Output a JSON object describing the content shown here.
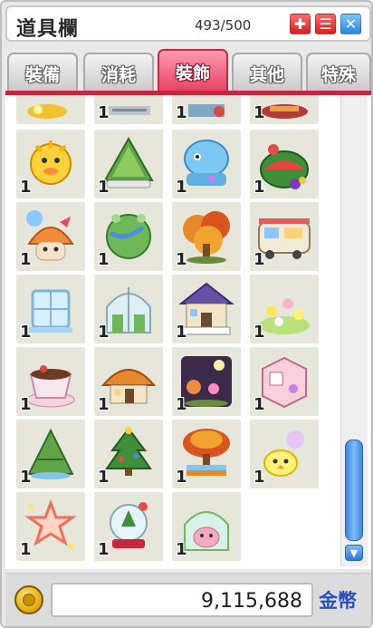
{
  "window": {
    "title": "道具欄",
    "capacity": "493/500",
    "buttons": [
      "add",
      "list",
      "close"
    ]
  },
  "tabs": [
    {
      "label": "裝備",
      "active": false
    },
    {
      "label": "消耗",
      "active": false
    },
    {
      "label": "裝飾",
      "active": true
    },
    {
      "label": "其他",
      "active": false
    },
    {
      "label": "特殊",
      "active": false
    }
  ],
  "colors": {
    "active_tab": "#e7405f",
    "accent_line": "#c8253e",
    "scroll": "#3d86e3",
    "currency_text": "#2c4fbf"
  },
  "items": [
    {
      "icon": "partial-top-item-1-icon",
      "count": ""
    },
    {
      "icon": "partial-top-item-2-icon",
      "count": "1"
    },
    {
      "icon": "partial-top-item-3-icon",
      "count": "1"
    },
    {
      "icon": "partial-top-item-4-icon",
      "count": "1"
    },
    {
      "icon": "yellow-sun-bird-icon",
      "count": "1"
    },
    {
      "icon": "green-rice-dumpling-icon",
      "count": "1"
    },
    {
      "icon": "blue-octopus-pot-icon",
      "count": "1"
    },
    {
      "icon": "watermelon-fruit-basket-icon",
      "count": "1"
    },
    {
      "icon": "mushroom-balloon-bow-icon",
      "count": "1"
    },
    {
      "icon": "green-planet-frog-icon",
      "count": "1"
    },
    {
      "icon": "autumn-tree-icon",
      "count": "1"
    },
    {
      "icon": "camper-trailer-icon",
      "count": "1"
    },
    {
      "icon": "ice-window-frame-icon",
      "count": "1"
    },
    {
      "icon": "greenhouse-dome-icon",
      "count": "1"
    },
    {
      "icon": "purple-roof-house-icon",
      "count": "1"
    },
    {
      "icon": "flower-meadow-icon",
      "count": "1"
    },
    {
      "icon": "coffee-cup-cake-icon",
      "count": "1"
    },
    {
      "icon": "mushroom-cottage-icon",
      "count": "1"
    },
    {
      "icon": "night-festival-icon",
      "count": "1"
    },
    {
      "icon": "pink-room-box-icon",
      "count": "1"
    },
    {
      "icon": "green-zongzi-icon",
      "count": "1"
    },
    {
      "icon": "christmas-tree-icon",
      "count": "1"
    },
    {
      "icon": "autumn-bonsai-icon",
      "count": "1"
    },
    {
      "icon": "chick-flower-icon",
      "count": "1"
    },
    {
      "icon": "sparkle-frame-icon",
      "count": "1"
    },
    {
      "icon": "snow-globe-icon",
      "count": "1"
    },
    {
      "icon": "pink-pig-dome-icon",
      "count": "1"
    }
  ],
  "money": {
    "icon": "gold-coin-icon",
    "amount": "9,115,688",
    "currency_label": "金幣"
  }
}
